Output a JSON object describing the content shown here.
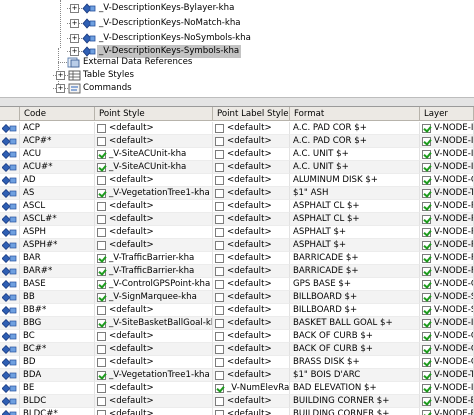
{
  "tree": {
    "items": [
      {
        "label": "_V-DescriptionKeys-Bylayer-kha",
        "icon": "description-key-set-icon"
      },
      {
        "label": "_V-DescriptionKeys-NoMatch-kha",
        "icon": "description-key-set-icon"
      },
      {
        "label": "_V-DescriptionKeys-NoSymbols-kha",
        "icon": "description-key-set-icon"
      },
      {
        "label": "_V-DescriptionKeys-Symbols-kha",
        "icon": "description-key-set-icon",
        "selected": true
      },
      {
        "label": "External Data References",
        "icon": "external-data-icon"
      },
      {
        "label": "Table Styles",
        "icon": "table-styles-icon"
      },
      {
        "label": "Commands",
        "icon": "commands-icon"
      }
    ]
  },
  "grid": {
    "headers": {
      "code": "Code",
      "point_style": "Point Style",
      "point_label_style": "Point Label Style",
      "format": "Format",
      "layer": "Layer"
    },
    "rows": [
      {
        "code": "ACP",
        "ps_on": false,
        "ps": "<default>",
        "pls_on": false,
        "pls": "<default>",
        "format": "A.C. PAD COR $+",
        "layer_on": true,
        "layer": "V-NODE-IM"
      },
      {
        "code": "ACP#*",
        "ps_on": false,
        "ps": "<default>",
        "pls_on": false,
        "pls": "<default>",
        "format": "A.C. PAD COR $+",
        "layer_on": true,
        "layer": "V-NODE-IM"
      },
      {
        "code": "ACU",
        "ps_on": true,
        "ps": "_V-SiteACUnit-kha",
        "pls_on": false,
        "pls": "<default>",
        "format": "A.C. UNIT $+",
        "layer_on": true,
        "layer": "V-NODE-IM"
      },
      {
        "code": "ACU#*",
        "ps_on": true,
        "ps": "_V-SiteACUnit-kha",
        "pls_on": false,
        "pls": "<default>",
        "format": "A.C. UNIT $+",
        "layer_on": true,
        "layer": "V-NODE-IM"
      },
      {
        "code": "AD",
        "ps_on": false,
        "ps": "<default>",
        "pls_on": false,
        "pls": "<default>",
        "format": "ALUMINUM DISK $+",
        "layer_on": true,
        "layer": "V-NODE-CT"
      },
      {
        "code": "AS",
        "ps_on": true,
        "ps": "_V-VegetationTree1-kha",
        "pls_on": false,
        "pls": "<default>",
        "format": "$1\" ASH",
        "layer_on": true,
        "layer": "V-NODE-TR"
      },
      {
        "code": "ASCL",
        "ps_on": false,
        "ps": "<default>",
        "pls_on": false,
        "pls": "<default>",
        "format": "ASPHALT CL $+",
        "layer_on": true,
        "layer": "V-NODE-PV"
      },
      {
        "code": "ASCL#*",
        "ps_on": false,
        "ps": "<default>",
        "pls_on": false,
        "pls": "<default>",
        "format": "ASPHALT CL $+",
        "layer_on": true,
        "layer": "V-NODE-PV"
      },
      {
        "code": "ASPH",
        "ps_on": false,
        "ps": "<default>",
        "pls_on": false,
        "pls": "<default>",
        "format": "ASPHALT  $+",
        "layer_on": true,
        "layer": "V-NODE-PV"
      },
      {
        "code": "ASPH#*",
        "ps_on": false,
        "ps": "<default>",
        "pls_on": false,
        "pls": "<default>",
        "format": "ASPHALT  $+",
        "layer_on": true,
        "layer": "V-NODE-PV"
      },
      {
        "code": "BAR",
        "ps_on": true,
        "ps": "_V-TrafficBarrier-kha",
        "pls_on": false,
        "pls": "<default>",
        "format": "BARRICADE $+",
        "layer_on": true,
        "layer": "V-NODE-FE"
      },
      {
        "code": "BAR#*",
        "ps_on": true,
        "ps": "_V-TrafficBarrier-kha",
        "pls_on": false,
        "pls": "<default>",
        "format": "BARRICADE $+",
        "layer_on": true,
        "layer": "V-NODE-FE"
      },
      {
        "code": "BASE",
        "ps_on": true,
        "ps": "_V-ControlGPSPoint-kha",
        "pls_on": false,
        "pls": "<default>",
        "format": "GPS BASE $+",
        "layer_on": true,
        "layer": "V-NODE-CT"
      },
      {
        "code": "BB",
        "ps_on": true,
        "ps": "_V-SignMarquee-kha",
        "pls_on": false,
        "pls": "<default>",
        "format": "BILLBOARD $+",
        "layer_on": true,
        "layer": "V-NODE-SI"
      },
      {
        "code": "BB#*",
        "ps_on": false,
        "ps": "<default>",
        "pls_on": false,
        "pls": "<default>",
        "format": "BILLBOARD $+",
        "layer_on": true,
        "layer": "V-NODE-SI"
      },
      {
        "code": "BBG",
        "ps_on": true,
        "ps": "_V-SiteBasketBallGoal-kha",
        "pls_on": false,
        "pls": "<default>",
        "format": "BASKET BALL GOAL $+",
        "layer_on": true,
        "layer": "V-NODE-IM"
      },
      {
        "code": "BC",
        "ps_on": false,
        "ps": "<default>",
        "pls_on": false,
        "pls": "<default>",
        "format": "BACK OF CURB $+",
        "layer_on": true,
        "layer": "V-NODE-CU"
      },
      {
        "code": "BC#*",
        "ps_on": false,
        "ps": "<default>",
        "pls_on": false,
        "pls": "<default>",
        "format": "BACK OF CURB $+",
        "layer_on": true,
        "layer": "V-NODE-CU"
      },
      {
        "code": "BD",
        "ps_on": false,
        "ps": "<default>",
        "pls_on": false,
        "pls": "<default>",
        "format": "BRASS DISK $+",
        "layer_on": true,
        "layer": "V-NODE-CT"
      },
      {
        "code": "BDA",
        "ps_on": true,
        "ps": "_V-VegetationTree1-kha",
        "pls_on": false,
        "pls": "<default>",
        "format": "$1\" BOIS D'ARC",
        "layer_on": true,
        "layer": "V-NODE-TR"
      },
      {
        "code": "BE",
        "ps_on": false,
        "ps": "<default>",
        "pls_on": true,
        "pls": "_V-NumElevRaw",
        "format": "BAD ELEVATION $+",
        "layer_on": true,
        "layer": "V-NODE-IM"
      },
      {
        "code": "BLDC",
        "ps_on": false,
        "ps": "<default>",
        "pls_on": false,
        "pls": "<default>",
        "format": "BUILDING CORNER $+",
        "layer_on": true,
        "layer": "V-NODE-BL"
      },
      {
        "code": "BLDC#*",
        "ps_on": false,
        "ps": "<default>",
        "pls_on": false,
        "pls": "<default>",
        "format": "BUILDING CORNER $+",
        "layer_on": true,
        "layer": "V-NODE-BL"
      }
    ]
  }
}
